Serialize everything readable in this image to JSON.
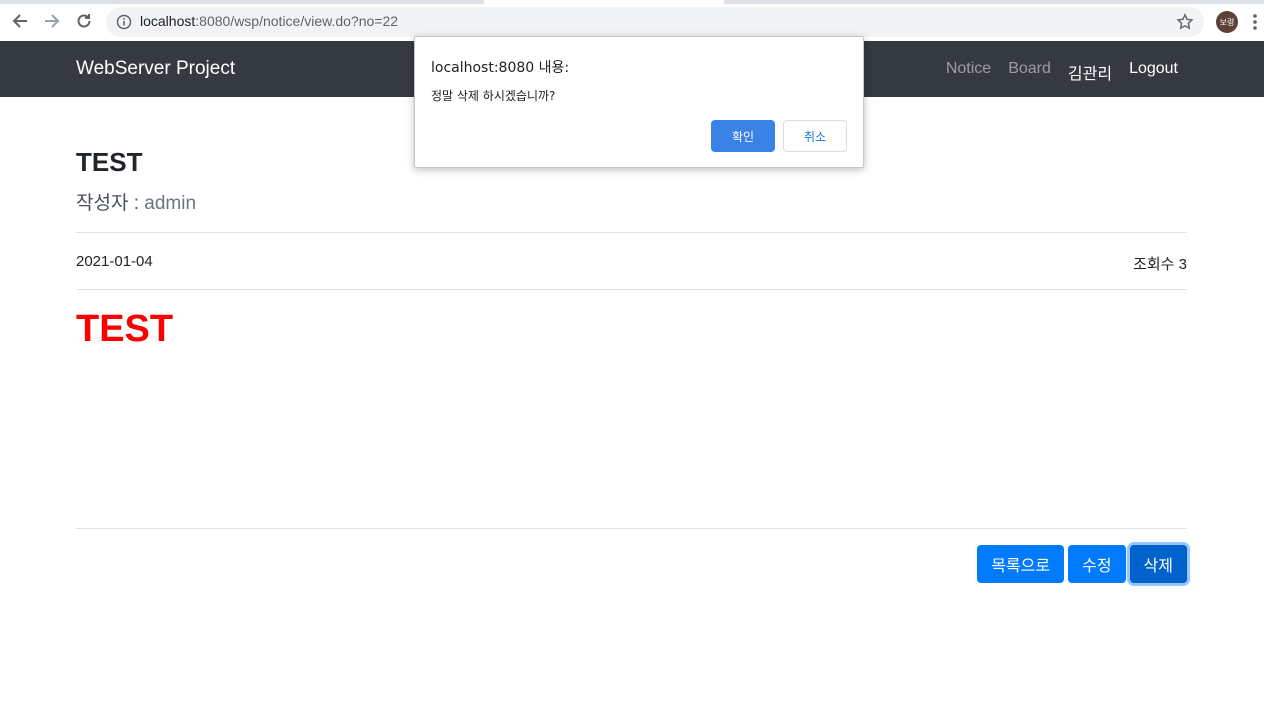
{
  "browser": {
    "url_host": "localhost",
    "url_path": ":8080/wsp/notice/view.do?no=22",
    "profile_initials": "보령"
  },
  "navbar": {
    "brand": "WebServer Project",
    "links": [
      "Notice",
      "Board",
      "김관리",
      "Logout"
    ]
  },
  "post": {
    "title": "TEST",
    "author_label": "작성자 : ",
    "author": "admin",
    "date": "2021-01-04",
    "views_label": "조회수 3",
    "body": "TEST",
    "body_color": "#ff0000"
  },
  "actions": {
    "list_label": "목록으로",
    "edit_label": "수정",
    "delete_label": "삭제"
  },
  "dialog": {
    "title": "localhost:8080 내용:",
    "message": "정말 삭제 하시겠습니까?",
    "ok_label": "확인",
    "cancel_label": "취소"
  },
  "colors": {
    "navbar": "#343a40",
    "primary": "#007bff",
    "dialog_ok": "#3b82e6"
  }
}
